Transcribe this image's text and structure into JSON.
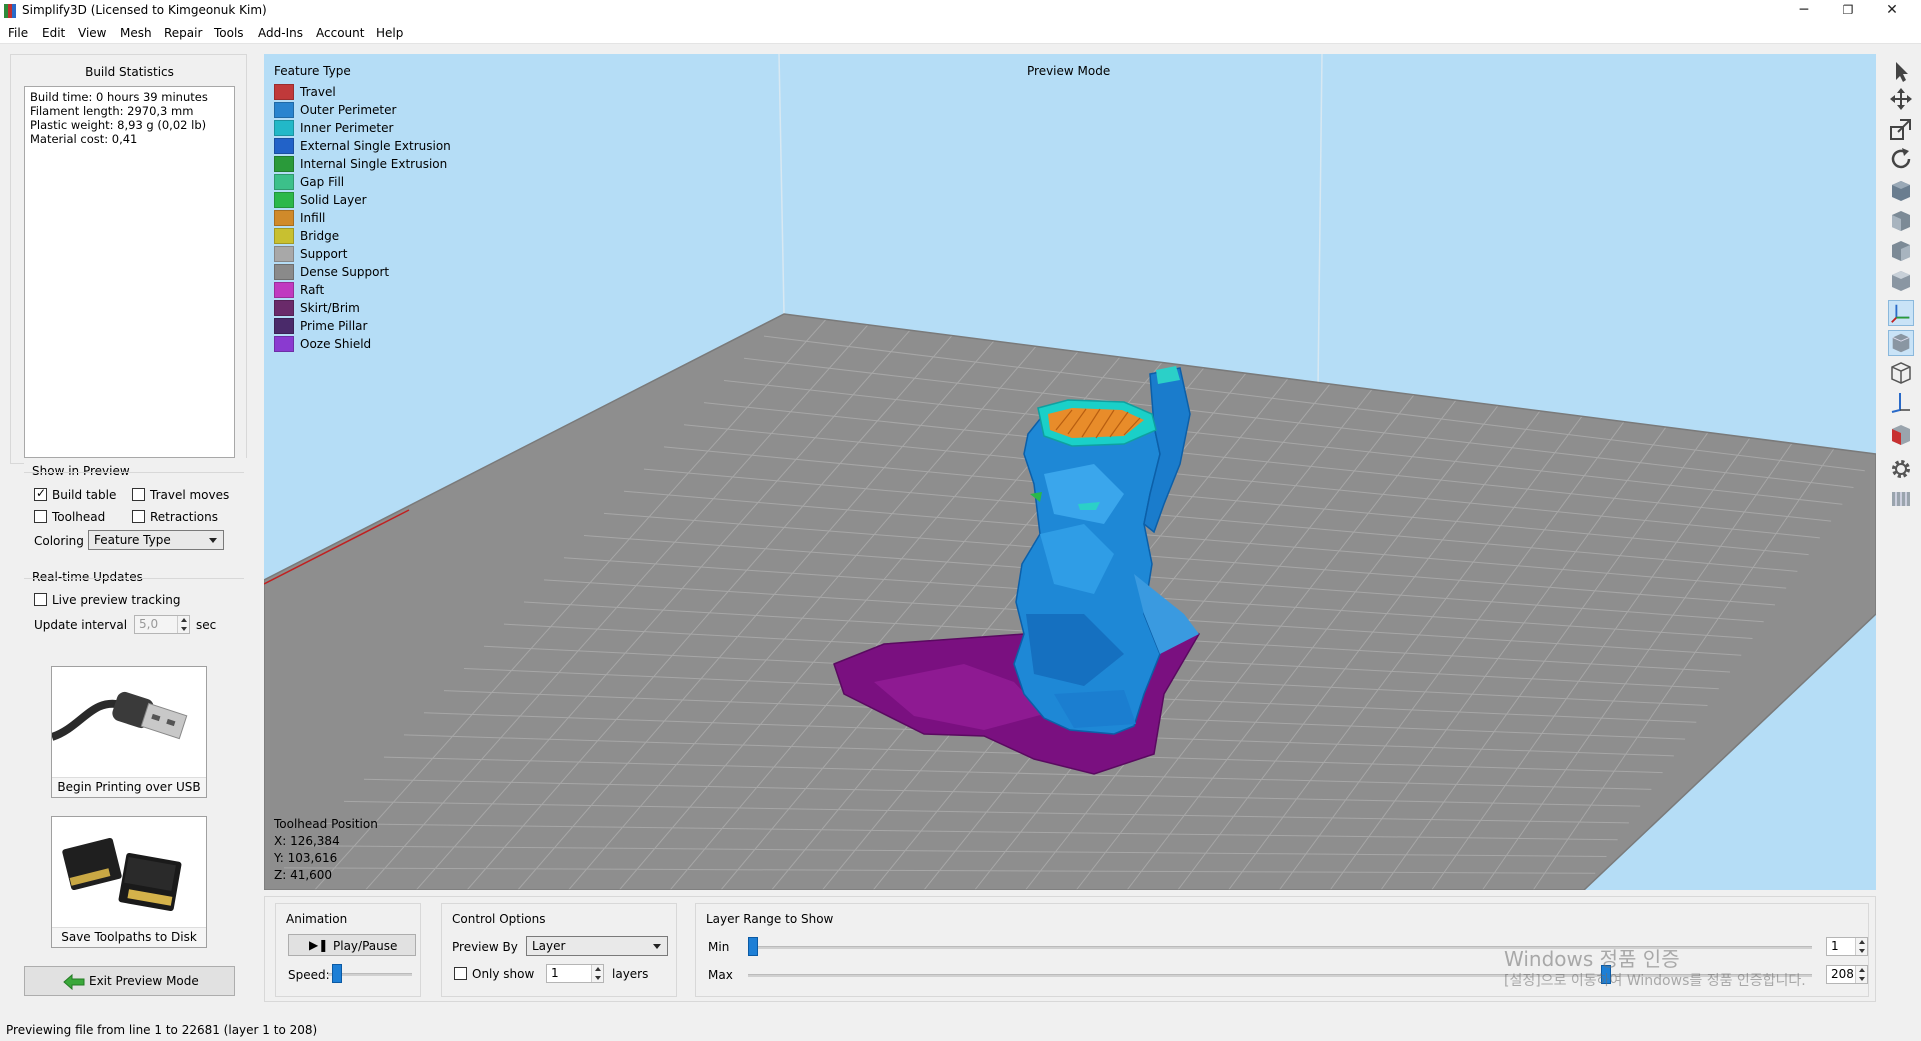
{
  "window": {
    "title": "Simplify3D (Licensed to Kimgeonuk Kim)",
    "minimize": "─",
    "restore": "❐",
    "close": "✕"
  },
  "menu": [
    "File",
    "Edit",
    "View",
    "Mesh",
    "Repair",
    "Tools",
    "Add-Ins",
    "Account",
    "Help"
  ],
  "build_statistics": {
    "title": "Build Statistics",
    "lines": [
      "Build time: 0 hours 39 minutes",
      "Filament length: 2970,3 mm",
      "Plastic weight: 8,93 g (0,02 lb)",
      "Material cost: 0,41"
    ]
  },
  "show_in_preview": {
    "title": "Show in Preview",
    "build_table": {
      "label": "Build table",
      "checked": true
    },
    "travel_moves": {
      "label": "Travel moves",
      "checked": false
    },
    "toolhead": {
      "label": "Toolhead",
      "checked": false
    },
    "retractions": {
      "label": "Retractions",
      "checked": false
    },
    "coloring_label": "Coloring",
    "coloring_value": "Feature Type"
  },
  "realtime_updates": {
    "title": "Real-time Updates",
    "live_tracking": {
      "label": "Live preview tracking",
      "checked": false
    },
    "interval_label": "Update interval",
    "interval_value": "5,0",
    "interval_unit": "sec"
  },
  "actions": {
    "usb_label": "Begin Printing over USB",
    "disk_label": "Save Toolpaths to Disk",
    "exit_label": "Exit Preview Mode"
  },
  "viewport": {
    "mode_label": "Preview Mode",
    "legend_title": "Feature Type",
    "legend": [
      {
        "name": "Travel",
        "color": "#c0393a"
      },
      {
        "name": "Outer Perimeter",
        "color": "#2a84cf"
      },
      {
        "name": "Inner Perimeter",
        "color": "#22b8c8"
      },
      {
        "name": "External Single Extrusion",
        "color": "#2262c8"
      },
      {
        "name": "Internal Single Extrusion",
        "color": "#2a9a3a"
      },
      {
        "name": "Gap Fill",
        "color": "#3cc08a"
      },
      {
        "name": "Solid Layer",
        "color": "#2cb84a"
      },
      {
        "name": "Infill",
        "color": "#d08a2a"
      },
      {
        "name": "Bridge",
        "color": "#c8c030"
      },
      {
        "name": "Support",
        "color": "#a8a8a8"
      },
      {
        "name": "Dense Support",
        "color": "#8a8a8a"
      },
      {
        "name": "Raft",
        "color": "#c03ac0"
      },
      {
        "name": "Skirt/Brim",
        "color": "#6a2a6a"
      },
      {
        "name": "Prime Pillar",
        "color": "#4a2a6a"
      },
      {
        "name": "Ooze Shield",
        "color": "#8a3ad0"
      }
    ],
    "toolhead_title": "Toolhead Position",
    "toolhead_x": "X: 126,384",
    "toolhead_y": "Y: 103,616",
    "toolhead_z": "Z: 41,600"
  },
  "right_toolbar": [
    "select-icon",
    "move-icon",
    "scale-icon",
    "rotate-icon",
    "view-default-icon",
    "view-front-icon",
    "view-side-icon",
    "view-top-icon",
    "axes-icon",
    "solid-shading-icon",
    "wireframe-icon",
    "cross-section-icon",
    "section-view-icon",
    "settings-gear-icon",
    "extra-icon"
  ],
  "animation": {
    "title": "Animation",
    "play_label": "Play/Pause",
    "speed_label": "Speed:"
  },
  "control_options": {
    "title": "Control Options",
    "preview_by_label": "Preview By",
    "preview_by_value": "Layer",
    "only_show_label": "Only show",
    "only_show_checked": false,
    "only_show_value": "1",
    "layers_label": "layers"
  },
  "layer_range": {
    "title": "Layer Range to Show",
    "min_label": "Min",
    "max_label": "Max",
    "min_value": "1",
    "max_value": "208",
    "total_layers": 208
  },
  "status": "Previewing file from line 1 to 22681 (layer 1 to 208)",
  "watermark": {
    "line1": "Windows 정품 인증",
    "line2": "[설정]으로 이동하여 Windows를 정품 인증합니다."
  }
}
